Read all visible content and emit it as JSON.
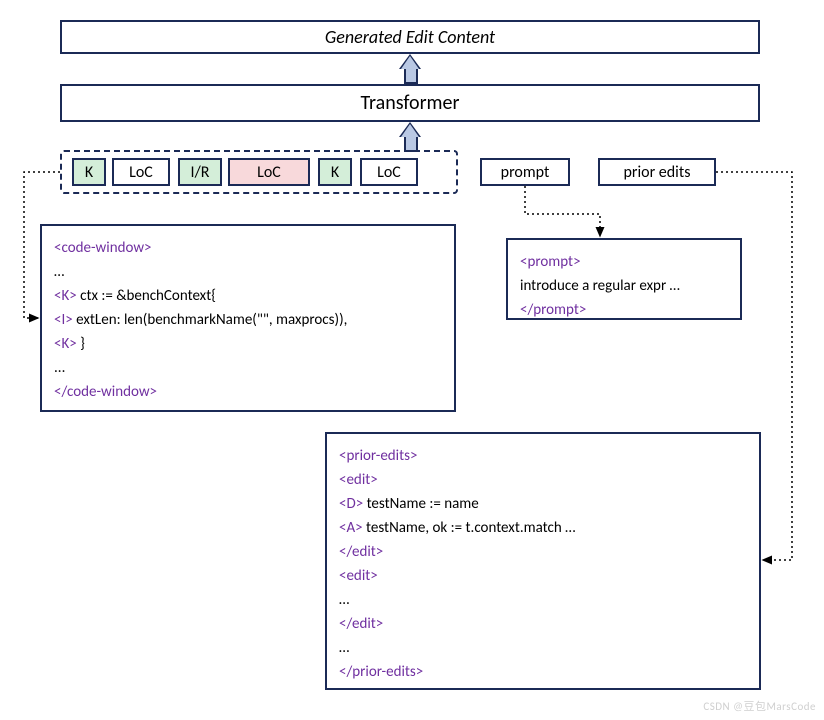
{
  "top": {
    "generated": "Generated Edit Content",
    "transformer": "Transformer"
  },
  "tokens": {
    "k": "K",
    "loc": "LoC",
    "ir": "I/R"
  },
  "labels": {
    "prompt": "prompt",
    "prior_edits": "prior edits"
  },
  "code_window": {
    "open": "<code-window>",
    "ell1": "…",
    "k1_tag": "<K>",
    "k1_text": " ctx := &benchContext{",
    "i_tag": "<I>",
    "i_text": " extLen: len(benchmarkName(\"\", maxprocs)),",
    "k2_tag": "<K>",
    "k2_text": " }",
    "ell2": "...",
    "close": "</code-window>"
  },
  "prompt_box": {
    "open": "<prompt>",
    "text": "introduce a regular expr …",
    "close": "</prompt>"
  },
  "prior_edits_box": {
    "open": "<prior-edits>",
    "edit_open": "<edit>",
    "d_tag": "<D>",
    "d_text": " testName := name",
    "a_tag": "<A>",
    "a_text": " testName, ok := t.context.match …",
    "edit_close": "</edit>",
    "edit2_open": "<edit>",
    "ell1": "…",
    "edit2_close": "</edit>",
    "ell2": "…",
    "close": "</prior-edits>"
  },
  "watermark": "CSDN @豆包MarsCode"
}
